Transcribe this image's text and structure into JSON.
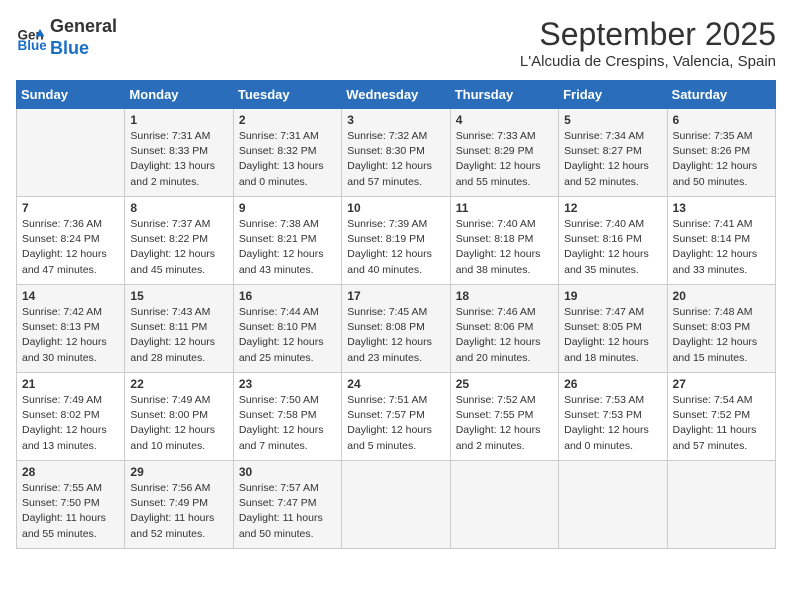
{
  "header": {
    "logo_line1": "General",
    "logo_line2": "Blue",
    "month": "September 2025",
    "location": "L'Alcudia de Crespins, Valencia, Spain"
  },
  "days_of_week": [
    "Sunday",
    "Monday",
    "Tuesday",
    "Wednesday",
    "Thursday",
    "Friday",
    "Saturday"
  ],
  "weeks": [
    [
      {
        "day": "",
        "sunrise": "",
        "sunset": "",
        "daylight": ""
      },
      {
        "day": "1",
        "sunrise": "Sunrise: 7:31 AM",
        "sunset": "Sunset: 8:33 PM",
        "daylight": "Daylight: 13 hours and 2 minutes."
      },
      {
        "day": "2",
        "sunrise": "Sunrise: 7:31 AM",
        "sunset": "Sunset: 8:32 PM",
        "daylight": "Daylight: 13 hours and 0 minutes."
      },
      {
        "day": "3",
        "sunrise": "Sunrise: 7:32 AM",
        "sunset": "Sunset: 8:30 PM",
        "daylight": "Daylight: 12 hours and 57 minutes."
      },
      {
        "day": "4",
        "sunrise": "Sunrise: 7:33 AM",
        "sunset": "Sunset: 8:29 PM",
        "daylight": "Daylight: 12 hours and 55 minutes."
      },
      {
        "day": "5",
        "sunrise": "Sunrise: 7:34 AM",
        "sunset": "Sunset: 8:27 PM",
        "daylight": "Daylight: 12 hours and 52 minutes."
      },
      {
        "day": "6",
        "sunrise": "Sunrise: 7:35 AM",
        "sunset": "Sunset: 8:26 PM",
        "daylight": "Daylight: 12 hours and 50 minutes."
      }
    ],
    [
      {
        "day": "7",
        "sunrise": "Sunrise: 7:36 AM",
        "sunset": "Sunset: 8:24 PM",
        "daylight": "Daylight: 12 hours and 47 minutes."
      },
      {
        "day": "8",
        "sunrise": "Sunrise: 7:37 AM",
        "sunset": "Sunset: 8:22 PM",
        "daylight": "Daylight: 12 hours and 45 minutes."
      },
      {
        "day": "9",
        "sunrise": "Sunrise: 7:38 AM",
        "sunset": "Sunset: 8:21 PM",
        "daylight": "Daylight: 12 hours and 43 minutes."
      },
      {
        "day": "10",
        "sunrise": "Sunrise: 7:39 AM",
        "sunset": "Sunset: 8:19 PM",
        "daylight": "Daylight: 12 hours and 40 minutes."
      },
      {
        "day": "11",
        "sunrise": "Sunrise: 7:40 AM",
        "sunset": "Sunset: 8:18 PM",
        "daylight": "Daylight: 12 hours and 38 minutes."
      },
      {
        "day": "12",
        "sunrise": "Sunrise: 7:40 AM",
        "sunset": "Sunset: 8:16 PM",
        "daylight": "Daylight: 12 hours and 35 minutes."
      },
      {
        "day": "13",
        "sunrise": "Sunrise: 7:41 AM",
        "sunset": "Sunset: 8:14 PM",
        "daylight": "Daylight: 12 hours and 33 minutes."
      }
    ],
    [
      {
        "day": "14",
        "sunrise": "Sunrise: 7:42 AM",
        "sunset": "Sunset: 8:13 PM",
        "daylight": "Daylight: 12 hours and 30 minutes."
      },
      {
        "day": "15",
        "sunrise": "Sunrise: 7:43 AM",
        "sunset": "Sunset: 8:11 PM",
        "daylight": "Daylight: 12 hours and 28 minutes."
      },
      {
        "day": "16",
        "sunrise": "Sunrise: 7:44 AM",
        "sunset": "Sunset: 8:10 PM",
        "daylight": "Daylight: 12 hours and 25 minutes."
      },
      {
        "day": "17",
        "sunrise": "Sunrise: 7:45 AM",
        "sunset": "Sunset: 8:08 PM",
        "daylight": "Daylight: 12 hours and 23 minutes."
      },
      {
        "day": "18",
        "sunrise": "Sunrise: 7:46 AM",
        "sunset": "Sunset: 8:06 PM",
        "daylight": "Daylight: 12 hours and 20 minutes."
      },
      {
        "day": "19",
        "sunrise": "Sunrise: 7:47 AM",
        "sunset": "Sunset: 8:05 PM",
        "daylight": "Daylight: 12 hours and 18 minutes."
      },
      {
        "day": "20",
        "sunrise": "Sunrise: 7:48 AM",
        "sunset": "Sunset: 8:03 PM",
        "daylight": "Daylight: 12 hours and 15 minutes."
      }
    ],
    [
      {
        "day": "21",
        "sunrise": "Sunrise: 7:49 AM",
        "sunset": "Sunset: 8:02 PM",
        "daylight": "Daylight: 12 hours and 13 minutes."
      },
      {
        "day": "22",
        "sunrise": "Sunrise: 7:49 AM",
        "sunset": "Sunset: 8:00 PM",
        "daylight": "Daylight: 12 hours and 10 minutes."
      },
      {
        "day": "23",
        "sunrise": "Sunrise: 7:50 AM",
        "sunset": "Sunset: 7:58 PM",
        "daylight": "Daylight: 12 hours and 7 minutes."
      },
      {
        "day": "24",
        "sunrise": "Sunrise: 7:51 AM",
        "sunset": "Sunset: 7:57 PM",
        "daylight": "Daylight: 12 hours and 5 minutes."
      },
      {
        "day": "25",
        "sunrise": "Sunrise: 7:52 AM",
        "sunset": "Sunset: 7:55 PM",
        "daylight": "Daylight: 12 hours and 2 minutes."
      },
      {
        "day": "26",
        "sunrise": "Sunrise: 7:53 AM",
        "sunset": "Sunset: 7:53 PM",
        "daylight": "Daylight: 12 hours and 0 minutes."
      },
      {
        "day": "27",
        "sunrise": "Sunrise: 7:54 AM",
        "sunset": "Sunset: 7:52 PM",
        "daylight": "Daylight: 11 hours and 57 minutes."
      }
    ],
    [
      {
        "day": "28",
        "sunrise": "Sunrise: 7:55 AM",
        "sunset": "Sunset: 7:50 PM",
        "daylight": "Daylight: 11 hours and 55 minutes."
      },
      {
        "day": "29",
        "sunrise": "Sunrise: 7:56 AM",
        "sunset": "Sunset: 7:49 PM",
        "daylight": "Daylight: 11 hours and 52 minutes."
      },
      {
        "day": "30",
        "sunrise": "Sunrise: 7:57 AM",
        "sunset": "Sunset: 7:47 PM",
        "daylight": "Daylight: 11 hours and 50 minutes."
      },
      {
        "day": "",
        "sunrise": "",
        "sunset": "",
        "daylight": ""
      },
      {
        "day": "",
        "sunrise": "",
        "sunset": "",
        "daylight": ""
      },
      {
        "day": "",
        "sunrise": "",
        "sunset": "",
        "daylight": ""
      },
      {
        "day": "",
        "sunrise": "",
        "sunset": "",
        "daylight": ""
      }
    ]
  ]
}
